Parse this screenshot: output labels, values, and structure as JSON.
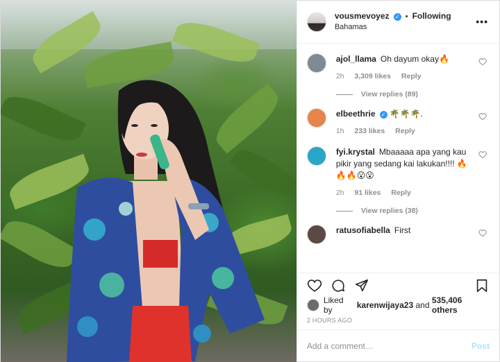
{
  "post": {
    "photo_alt": "photo",
    "author": {
      "username": "vousmevoyez",
      "verified_glyph": "✓",
      "separator": "•",
      "follow_status": "Following",
      "location": "Bahamas"
    },
    "more_glyph": "•••"
  },
  "comments": [
    {
      "username": "ajol_llama",
      "text": "Oh dayum okay🔥",
      "time": "2h",
      "likes": "3,309 likes",
      "reply": "Reply",
      "view_replies": "View replies (89)",
      "verified": false,
      "avatar_color": "#7d8a92"
    },
    {
      "username": "elbeethrie",
      "text": "🌴🌴🌴.",
      "time": "1h",
      "likes": "233 likes",
      "reply": "Reply",
      "view_replies": "",
      "verified": true,
      "avatar_color": "#e9834c"
    },
    {
      "username": "fyi.krystal",
      "text": "Mbaaaaa apa yang kau pikir yang sedang kai lakukan!!!! 🔥🔥🔥😮😮",
      "time": "2h",
      "likes": "91 likes",
      "reply": "Reply",
      "view_replies": "View replies (38)",
      "verified": false,
      "avatar_color": "#2aa6c9"
    },
    {
      "username": "ratusofiabella",
      "text": "First",
      "time": "",
      "likes": "",
      "reply": "",
      "view_replies": "",
      "verified": false,
      "avatar_color": "#5b4a43"
    }
  ],
  "actions": {
    "like_icon": "heart-outline-icon",
    "comment_icon": "comment-icon",
    "share_icon": "paper-plane-icon",
    "save_icon": "bookmark-icon"
  },
  "likes": {
    "prefix": "Liked by",
    "user": "karenwijaya23",
    "middle": "and",
    "count": "535,406 others"
  },
  "timestamp": "2 HOURS AGO",
  "composer": {
    "placeholder": "Add a comment…",
    "post_label": "Post"
  },
  "colors": {
    "verified": "#3897f0",
    "muted": "#8e8e8e",
    "post_disabled": "#b2dffc",
    "border": "#efefef"
  }
}
